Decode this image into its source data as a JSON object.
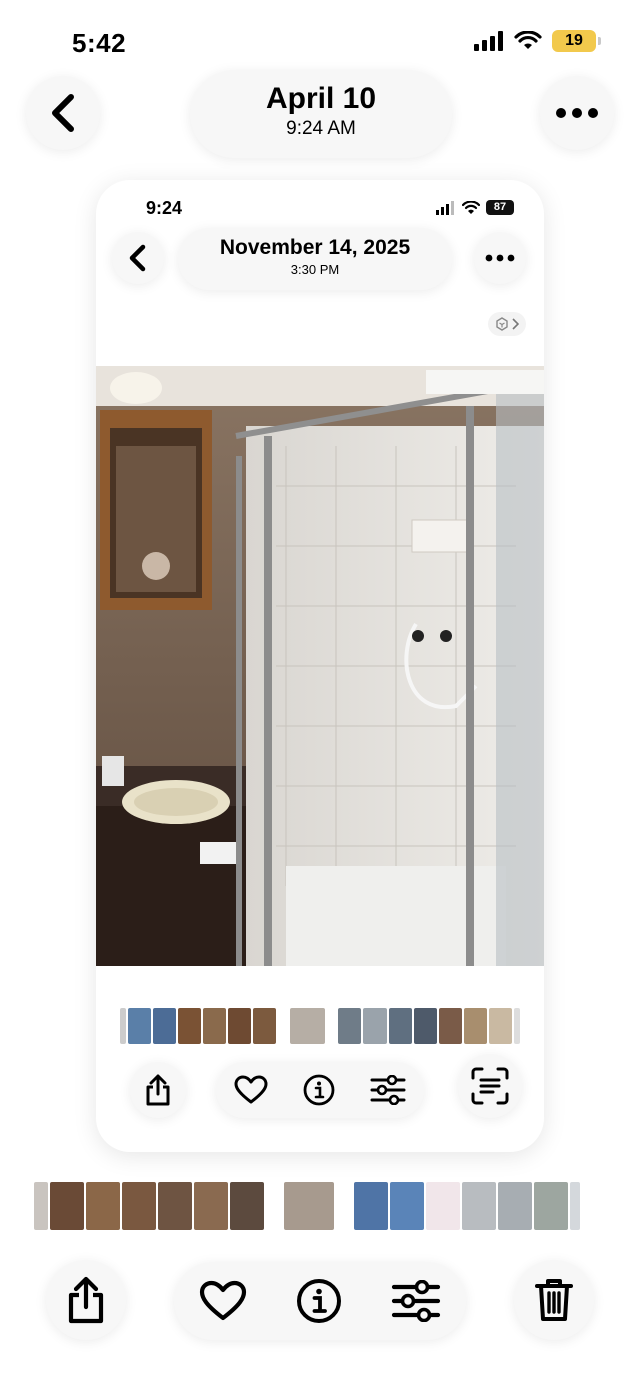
{
  "status_bar": {
    "time": "5:42",
    "battery": "19"
  },
  "header": {
    "title": "April 10",
    "subtitle": "9:24 AM"
  },
  "inner_screenshot": {
    "status_bar": {
      "time": "9:24",
      "battery": "87"
    },
    "header": {
      "title": "November 14, 2025",
      "subtitle": "3:30 PM"
    }
  },
  "icons": {
    "back": "chevron-left-icon",
    "more": "ellipsis-icon",
    "share": "share-icon",
    "favorite": "heart-icon",
    "info": "info-icon",
    "adjust": "sliders-icon",
    "live_text": "text-scan-icon",
    "delete": "trash-icon",
    "visual_lookup": "visual-lookup-icon"
  },
  "colors": {
    "battery_low": "#f2c94c",
    "background": "#ffffff",
    "button_fill": "#f7f7f7"
  }
}
